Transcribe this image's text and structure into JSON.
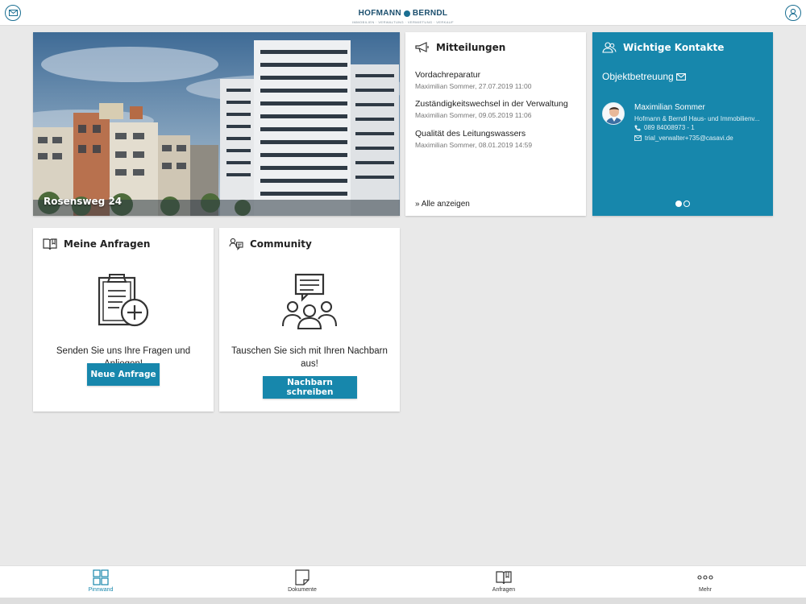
{
  "header": {
    "logo_text_left": "HOFMANN",
    "logo_text_right": "BERNDL",
    "logo_subtitle": "IMMOBILIEN · VERWALTUNG · VERMIETUNG · VERKAUF",
    "left_icon": "mail-icon",
    "right_icon": "user-icon"
  },
  "hero": {
    "label": "Rosensweg 24"
  },
  "news": {
    "title": "Mitteilungen",
    "icon": "megaphone-icon",
    "items": [
      {
        "title": "Vordachreparatur",
        "meta": "Maximilian Sommer, 27.07.2019 11:00"
      },
      {
        "title": "Zuständigkeitswechsel in der Verwaltung",
        "meta": "Maximilian Sommer, 09.05.2019 11:06"
      },
      {
        "title": "Qualität des Leitungswassers",
        "meta": "Maximilian Sommer, 08.01.2019 14:59"
      }
    ],
    "all_link": "» Alle anzeigen"
  },
  "contacts": {
    "title": "Wichtige Kontakte",
    "icon": "users-icon",
    "section_label": "Objektbetreuung",
    "name": "Maximilian Sommer",
    "company": "Hofmann & Berndl Haus- und Immobilienv...",
    "phone": "089 84008973 - 1",
    "email": "trial_verwalter+735@casavi.de",
    "pages_total": 2,
    "page_active": 1
  },
  "requests": {
    "title": "Meine Anfragen",
    "text": "Senden Sie uns Ihre Fragen und Anliegen!",
    "button": "Neue Anfrage"
  },
  "community": {
    "title": "Community",
    "text": "Tauschen Sie sich mit Ihren Nachbarn aus!",
    "button": "Nachbarn schreiben"
  },
  "nav": {
    "items": [
      {
        "label": "Pinnwand",
        "icon": "grid-icon",
        "active": true
      },
      {
        "label": "Dokumente",
        "icon": "document-icon",
        "active": false
      },
      {
        "label": "Anfragen",
        "icon": "book-icon",
        "active": false
      },
      {
        "label": "Mehr",
        "icon": "more-icon",
        "active": false
      }
    ]
  },
  "colors": {
    "accent": "#1787ac",
    "background": "#e9e9e9",
    "card": "#ffffff"
  }
}
